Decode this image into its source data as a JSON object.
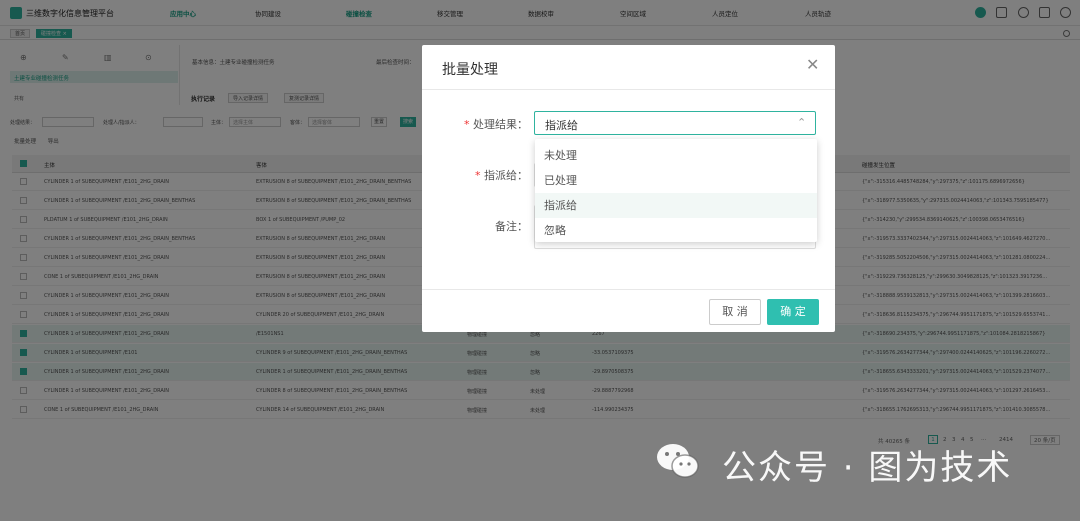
{
  "app": {
    "title": "三维数字化信息管理平台"
  },
  "nav": [
    "应用中心",
    "协同建设",
    "碰撞检查",
    "移交管理",
    "数据校审",
    "空间区域",
    "人员定位",
    "人员轨迹"
  ],
  "subbar": {
    "tab1": "首页",
    "tab2": "碰撞检查 ×"
  },
  "left_panel": {
    "selected_item": "土建专业碰撞检测任务",
    "footer": "共有"
  },
  "info": {
    "name": "基本信息：土建专业碰撞检测任务",
    "other": "最后检查时间："
  },
  "tabs": {
    "label": "执行记录",
    "tab1": "导入记录详情",
    "tab2": "复测记录详情"
  },
  "filter": {
    "result_label": "处理结果：",
    "assignee_label": "处理人/指派人：",
    "subject_label": "主体：",
    "subject_placeholder": "选择主体",
    "guest_label": "客体：",
    "guest_placeholder": "选择客体",
    "reset": "重置",
    "search": "搜索"
  },
  "actions": {
    "batch": "批量处理",
    "export": "导出"
  },
  "table": {
    "headers": {
      "subject": "主体",
      "object": "客体",
      "coord": "碰撞发生位置"
    },
    "rows": [
      {
        "s": "CYLINDER 1 of SUBEQUIPMENT /E101_2HG_DRAIN",
        "o": "EXTRUSION 8 of SUBEQUIPMENT /E101_2HG_DRAIN_BENTHAS",
        "c": "{\"x\":-315316.4485748284,\"y\":297375,\"z\":101175.6896972656}",
        "sel": false
      },
      {
        "s": "CYLINDER 1 of SUBEQUIPMENT /E101_2HG_DRAIN_BENTHAS",
        "o": "EXTRUSION 8 of SUBEQUIPMENT /E101_2HG_DRAIN_BENTHAS",
        "c": "{\"x\":-318977.5350635,\"y\":297315.0024414063,\"z\":101343.7595185477}",
        "sel": false
      },
      {
        "s": "PLDATUM 1 of SUBEQUIPMENT /E101_2HG_DRAIN",
        "o": "BOX 1 of SUBEQUIPMENT /PUMP_02",
        "c": "{\"x\":-314230,\"y\":299534.8369140625,\"z\":100398.0653476516}",
        "sel": false
      },
      {
        "s": "CYLINDER 1 of SUBEQUIPMENT /E101_2HG_DRAIN_BENTHAS",
        "o": "EXTRUSION 8 of SUBEQUIPMENT /E101_2HG_DRAIN",
        "c": "{\"x\":-319573.3337402344,\"y\":297315.0024414063,\"z\":101649.4627270...",
        "sel": false
      },
      {
        "s": "CYLINDER 1 of SUBEQUIPMENT /E101_2HG_DRAIN",
        "o": "EXTRUSION 8 of SUBEQUIPMENT /E101_2HG_DRAIN",
        "c": "{\"x\":-319285.5052204506,\"y\":297315.0024414063,\"z\":101281.0800224...",
        "sel": false
      },
      {
        "s": "CONE 1 of SUBEQUIPMENT /E101_2HG_DRAIN",
        "o": "EXTRUSION 8 of SUBEQUIPMENT /E101_2HG_DRAIN",
        "c": "{\"x\":-319229.736328125,\"y\":299630.3049828125,\"z\":101323.3917236...",
        "sel": false
      },
      {
        "s": "CYLINDER 1 of SUBEQUIPMENT /E101_2HG_DRAIN",
        "o": "EXTRUSION 8 of SUBEQUIPMENT /E101_2HG_DRAIN",
        "c": "{\"x\":-318888.9539132813,\"y\":297315.0024414063,\"z\":101399.2816603...",
        "sel": false
      },
      {
        "s": "CYLINDER 1 of SUBEQUIPMENT /E101_2HG_DRAIN",
        "o": "CYLINDER 20 of SUBEQUIPMENT /E101_2HG_DRAIN",
        "c": "{\"x\":-318636.8115234375,\"y\":296744.9951171875,\"z\":101529.6553741...",
        "sel": false
      },
      {
        "s": "CYLINDER 1 of SUBEQUIPMENT /E101_2HG_DRAIN",
        "o": "/E1501NS1",
        "t": "物理碰撞",
        "st": "忽略",
        "v": "2267",
        "c": "{\"x\":-318690.234375,\"y\":296744.9951171875,\"z\":101084.2818215867}",
        "sel": true
      },
      {
        "s": "CYLINDER 1 of SUBEQUIPMENT /E101",
        "o": "CYLINDER 9 of SUBEQUIPMENT /E101_2HG_DRAIN_BENTHAS",
        "t": "物理碰撞",
        "st": "忽略",
        "v": "-33.0537109375",
        "c": "{\"x\":-319576.2634277344,\"y\":297400.0244140625,\"z\":101196.2260272...",
        "sel": true
      },
      {
        "s": "CYLINDER 1 of SUBEQUIPMENT /E101_2HG_DRAIN",
        "o": "CYLINDER 1 of SUBEQUIPMENT /E101_2HG_DRAIN_BENTHAS",
        "t": "物理碰撞",
        "st": "忽略",
        "v": "-29.8970508375",
        "c": "{\"x\":-318655.6343333201,\"y\":297315.0024414063,\"z\":101529.2374077...",
        "sel": true
      },
      {
        "s": "CYLINDER 1 of SUBEQUIPMENT /E101_2HG_DRAIN",
        "o": "CYLINDER 8 of SUBEQUIPMENT /E101_2HG_DRAIN_BENTHAS",
        "t": "物理碰撞",
        "st": "未处理",
        "v": "-29.8887792968",
        "c": "{\"x\":-319576.2634277344,\"y\":297315.0024414063,\"z\":101297.2616453...",
        "sel": false
      },
      {
        "s": "CONE 1 of SUBEQUIPMENT /E101_2HG_DRAIN",
        "o": "CYLINDER 14 of SUBEQUIPMENT /E101_2HG_DRAIN",
        "t": "物理碰撞",
        "st": "未处理",
        "v": "-114.990234375",
        "c": "{\"x\":-318655.1762695313,\"y\":296744.9951171875,\"z\":101410.3085578...",
        "sel": false
      }
    ]
  },
  "pager": {
    "total": "共 40265 条",
    "pages": [
      "1",
      "2",
      "3",
      "4",
      "5",
      "···",
      "2414"
    ],
    "size": "20 条/页"
  },
  "modal": {
    "title": "批量处理",
    "result_label": "处理结果：",
    "result_value": "指派给",
    "assign_label": "指派给：",
    "note_label": "备注：",
    "options": [
      "未处理",
      "已处理",
      "指派给",
      "忽略"
    ],
    "cancel": "取 消",
    "confirm": "确 定"
  },
  "watermark": {
    "text": "公众号 · 图为技术"
  },
  "colors": {
    "accent": "#2fb39f",
    "required": "#ee3333",
    "confirm": "#2fbfb0"
  }
}
